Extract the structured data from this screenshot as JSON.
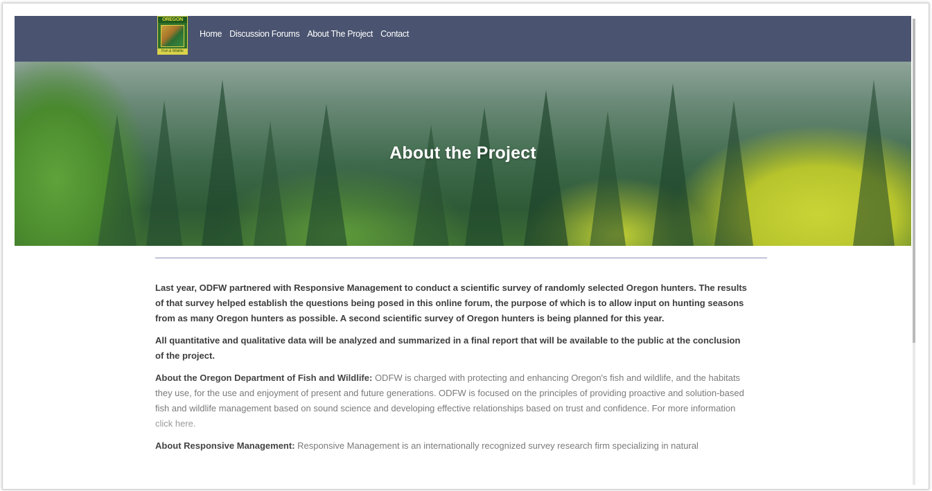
{
  "nav": {
    "logo_text": "OREGON",
    "logo_subtext": "Fish & Wildlife",
    "items": [
      {
        "label": "Home"
      },
      {
        "label": "Discussion Forums"
      },
      {
        "label": "About The Project"
      },
      {
        "label": "Contact"
      }
    ]
  },
  "hero": {
    "title": "About the Project"
  },
  "content": {
    "p1": "Last year, ODFW partnered with Responsive Management to conduct a scientific survey of randomly selected Oregon hunters. The results of that survey helped establish the questions being posed in this online forum, the purpose of which is to allow input on hunting seasons from as many Oregon hunters as possible. A second scientific survey of Oregon hunters is being planned for this year.",
    "p2": "All quantitative and qualitative data will be analyzed and summarized in a final report that will be available to the public at the conclusion of the project.",
    "p3_lead": "About the Oregon Department of Fish and Wildlife:",
    "p3_body": " ODFW is charged with protecting and enhancing Oregon's fish and wildlife, and the habitats they use, for the use and enjoyment of present and future generations. ODFW is focused on the principles of providing proactive and solution-based fish and wildlife management based on sound science and developing effective relationships based on trust and confidence. For more information ",
    "p3_link": "click here.",
    "p4_lead": "About Responsive Management:",
    "p4_body": " Responsive Management is an internationally recognized survey research firm specializing in natural"
  }
}
